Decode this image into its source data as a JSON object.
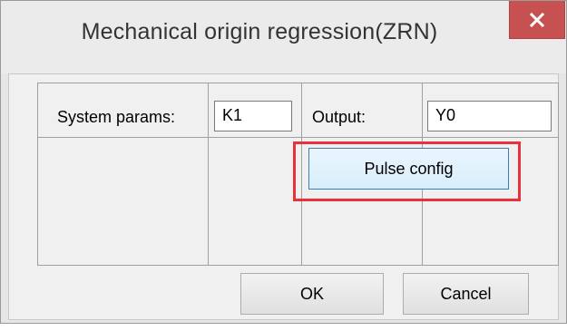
{
  "window": {
    "title": "Mechanical origin regression(ZRN)",
    "close_glyph": "✕",
    "close_icon": "close-icon",
    "accent_close": "#c75050"
  },
  "form": {
    "system_params_label": "System params:",
    "system_params_value": "K1",
    "output_label": "Output:",
    "output_value": "Y0",
    "pulse_config_label": "Pulse config"
  },
  "actions": {
    "ok_label": "OK",
    "cancel_label": "Cancel"
  },
  "annotation": {
    "highlight_color": "#e8313a"
  }
}
